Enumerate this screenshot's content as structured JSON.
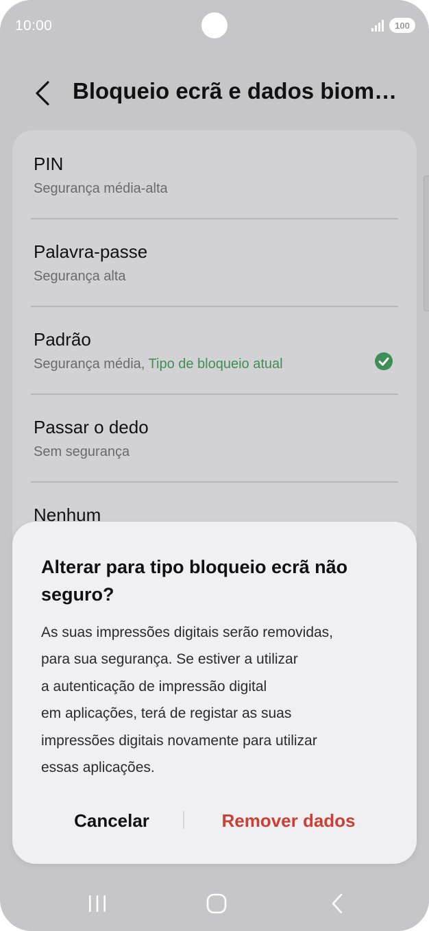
{
  "status_bar": {
    "time": "10:00",
    "battery": "100",
    "signal_icon": "signal-icon"
  },
  "header": {
    "title": "Bloqueio ecrã e dados biométricos",
    "back_icon": "back-icon"
  },
  "options": [
    {
      "title": "PIN",
      "subtitle": "Segurança média-alta"
    },
    {
      "title": "Palavra-passe",
      "subtitle": "Segurança alta"
    },
    {
      "title": "Padrão",
      "subtitle": "Segurança média, ",
      "current_label": "Tipo de bloqueio atual",
      "selected": true
    },
    {
      "title": "Passar o dedo",
      "subtitle": "Sem segurança"
    },
    {
      "title": "Nenhum"
    }
  ],
  "colors": {
    "accent_green": "#3f8e57",
    "destructive_red": "#c94036"
  },
  "dialog": {
    "title": "Alterar para tipo bloqueio ecrã não seguro?",
    "body_lines": [
      "As suas impressões digitais serão removidas,",
      "para sua segurança. Se estiver a utilizar",
      "a autenticação de impressão digital",
      "em aplicações, terá de registar as suas",
      "impressões digitais novamente para utilizar",
      "essas aplicações."
    ],
    "cancel_label": "Cancelar",
    "confirm_label": "Remover dados"
  },
  "nav_bar": {
    "recents_icon": "recents-icon",
    "home_icon": "home-icon",
    "back_icon": "back-icon"
  }
}
